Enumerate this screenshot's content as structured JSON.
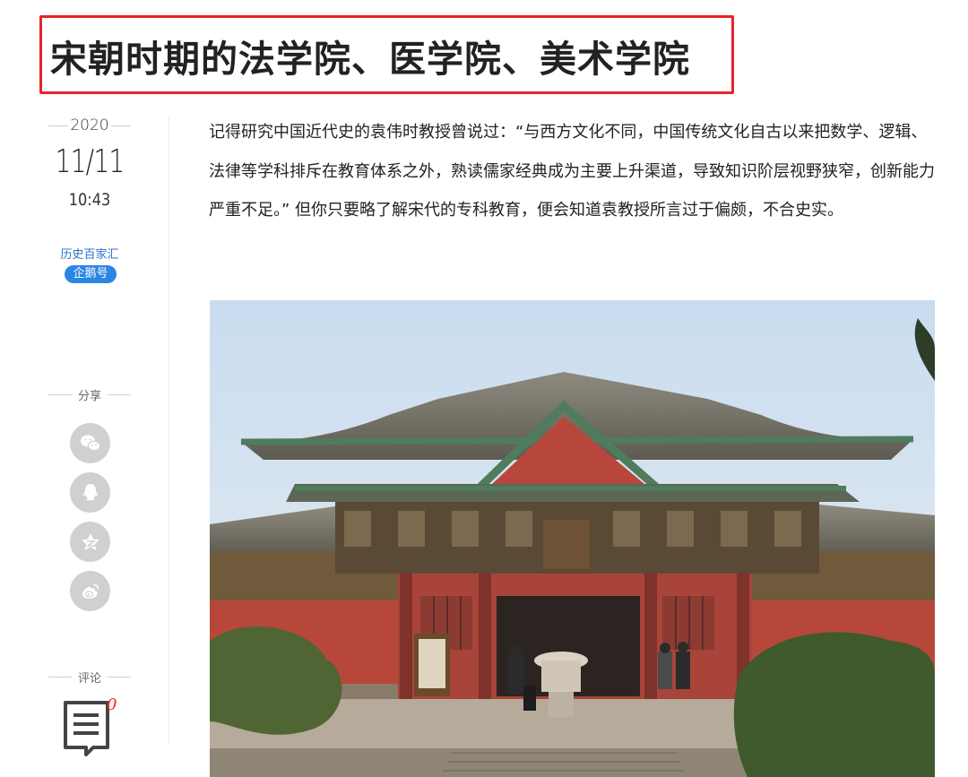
{
  "article": {
    "title": "宋朝时期的法学院、医学院、美术学院",
    "paragraph": "记得研究中国近代史的袁伟时教授曾说过：“与西方文化不同，中国传统文化自古以来把数学、逻辑、法律等学科排斥在教育体系之外，熟读儒家经典成为主要上升渠道，导致知识阶层视野狭窄，创新能力严重不足。” 但你只要略了解宋代的专科教育，便会知道袁教授所言过于偏颇，不合史实。"
  },
  "meta": {
    "year": "2020",
    "date": "11/11",
    "time": "10:43",
    "source": "历史百家汇",
    "badge": "企鹅号"
  },
  "share": {
    "label": "分享",
    "buttons": [
      "wechat-icon",
      "qq-icon",
      "qzone-icon",
      "weibo-icon"
    ]
  },
  "comment": {
    "label": "评论",
    "count": "0"
  },
  "colors": {
    "title_border": "#e8242b",
    "link": "#2a74c9",
    "badge_bg": "#2b86e3",
    "share_bg": "#d0d0d0"
  }
}
